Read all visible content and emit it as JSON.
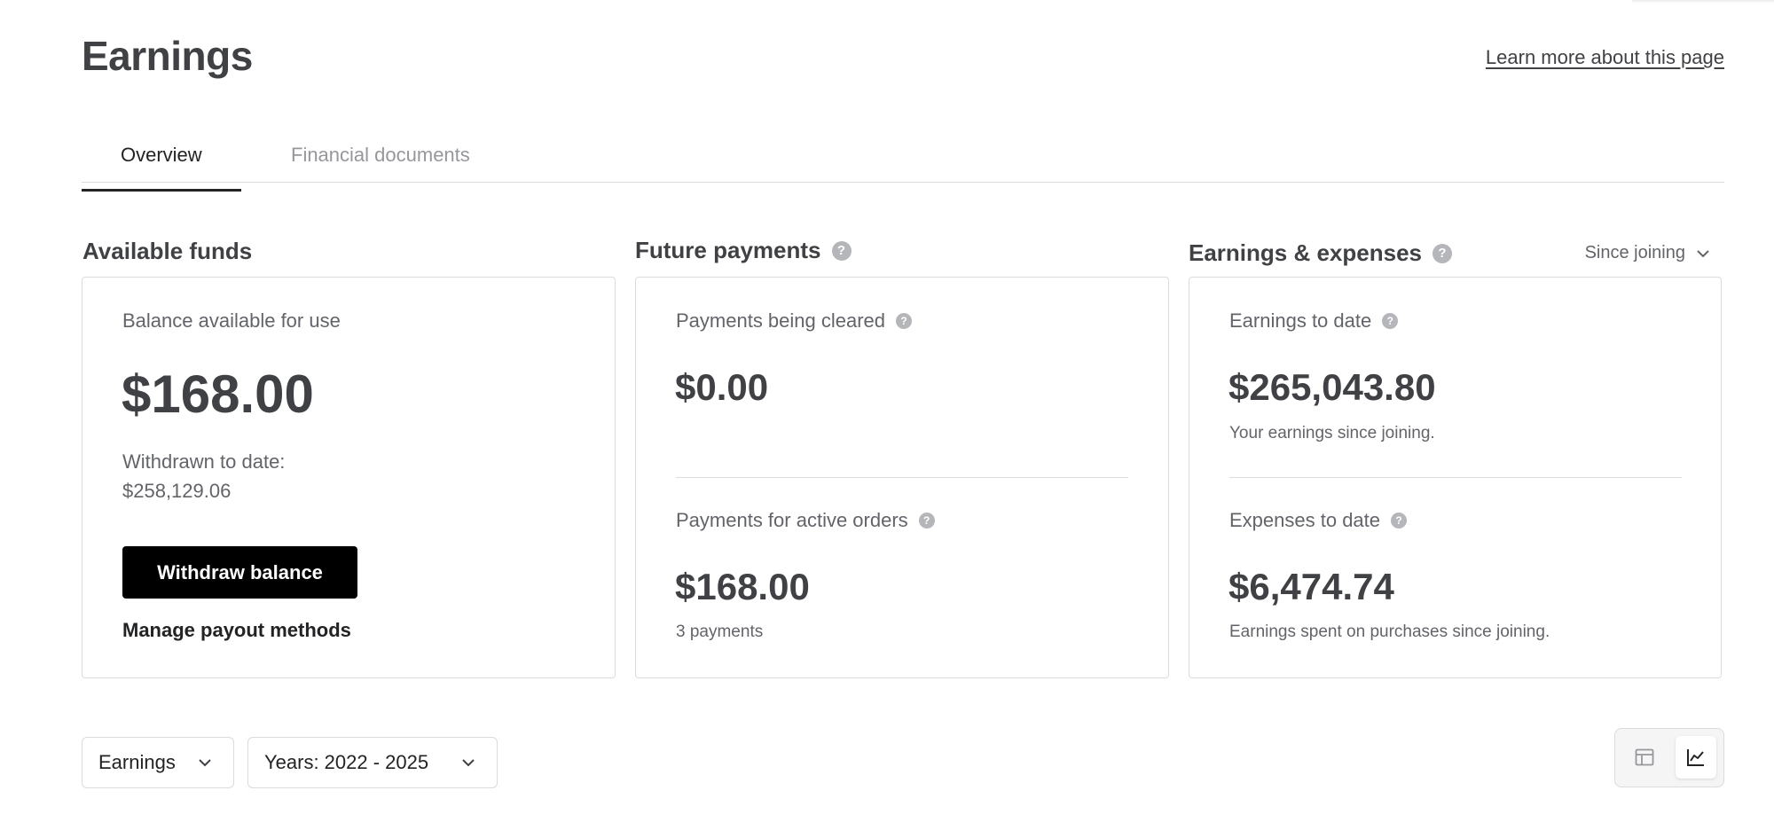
{
  "page": {
    "title": "Earnings",
    "learn_more": "Learn more about this page"
  },
  "tabs": [
    {
      "label": "Overview",
      "active": true
    },
    {
      "label": "Financial documents",
      "active": false
    }
  ],
  "available_funds": {
    "title": "Available funds",
    "balance_label": "Balance available for use",
    "balance_value": "$168.00",
    "withdrawn_label": "Withdrawn to date:",
    "withdrawn_value": "$258,129.06",
    "withdraw_button": "Withdraw balance",
    "manage_link": "Manage payout methods"
  },
  "future_payments": {
    "title": "Future payments",
    "cleared_label": "Payments being cleared",
    "cleared_value": "$0.00",
    "active_label": "Payments for active orders",
    "active_value": "$168.00",
    "active_sub": "3 payments"
  },
  "earnings_expenses": {
    "title": "Earnings & expenses",
    "period": "Since joining",
    "earnings_label": "Earnings to date",
    "earnings_value": "$265,043.80",
    "earnings_sub": "Your earnings since joining.",
    "expenses_label": "Expenses to date",
    "expenses_value": "$6,474.74",
    "expenses_sub": "Earnings spent on purchases since joining."
  },
  "filters": {
    "metric": "Earnings",
    "years": "Years: 2022 - 2025"
  },
  "icons": {
    "help": "question-circle-icon",
    "chevron": "chevron-down-icon",
    "table_view": "table-icon",
    "chart_view": "line-chart-icon"
  },
  "colors": {
    "primary_text": "#404145",
    "button_bg": "#000000",
    "border": "#dadbdd",
    "muted": "#95979d"
  }
}
